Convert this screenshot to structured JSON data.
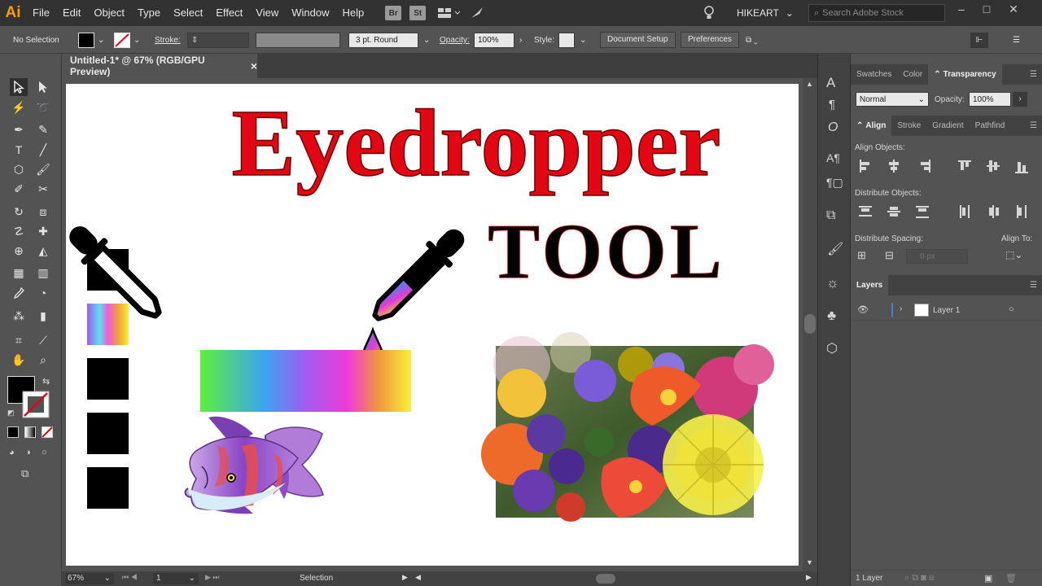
{
  "menubar": {
    "logo": "Ai",
    "menus": [
      "File",
      "Edit",
      "Object",
      "Type",
      "Select",
      "Effect",
      "View",
      "Window",
      "Help"
    ],
    "bridge": "Br",
    "stock": "St",
    "workspace": "HIKEART",
    "search_placeholder": "Search Adobe Stock"
  },
  "control": {
    "selection_status": "No Selection",
    "stroke_label": "Stroke:",
    "brush": "3 pt. Round",
    "opacity_label": "Opacity:",
    "opacity_value": "100%",
    "style_label": "Style:",
    "document_setup": "Document Setup",
    "preferences": "Preferences"
  },
  "document": {
    "tab_title": "Untitled-1* @ 67% (RGB/GPU Preview)",
    "close": "×"
  },
  "artboard": {
    "title": "Eyedropper",
    "subtitle": "TOOL"
  },
  "status": {
    "zoom": "67%",
    "artboard_num": "1",
    "tool": "Selection"
  },
  "panels": {
    "tabs1": [
      "Swatches",
      "Color",
      "Transparency"
    ],
    "blend_mode": "Normal",
    "opacity_label": "Opacity:",
    "opacity_value": "100%",
    "tabs2": [
      "Align",
      "Stroke",
      "Gradient",
      "Pathfind"
    ],
    "align_objects": "Align Objects:",
    "distribute_objects": "Distribute Objects:",
    "distribute_spacing": "Distribute Spacing:",
    "align_to": "Align To:",
    "spacing_value": "0 px",
    "layers_tab": "Layers",
    "layer_name": "Layer 1",
    "layer_count": "1 Layer"
  },
  "colors": {
    "title_red": "#e30613",
    "ui_dark": "#323232",
    "ui_panel": "#535353"
  }
}
